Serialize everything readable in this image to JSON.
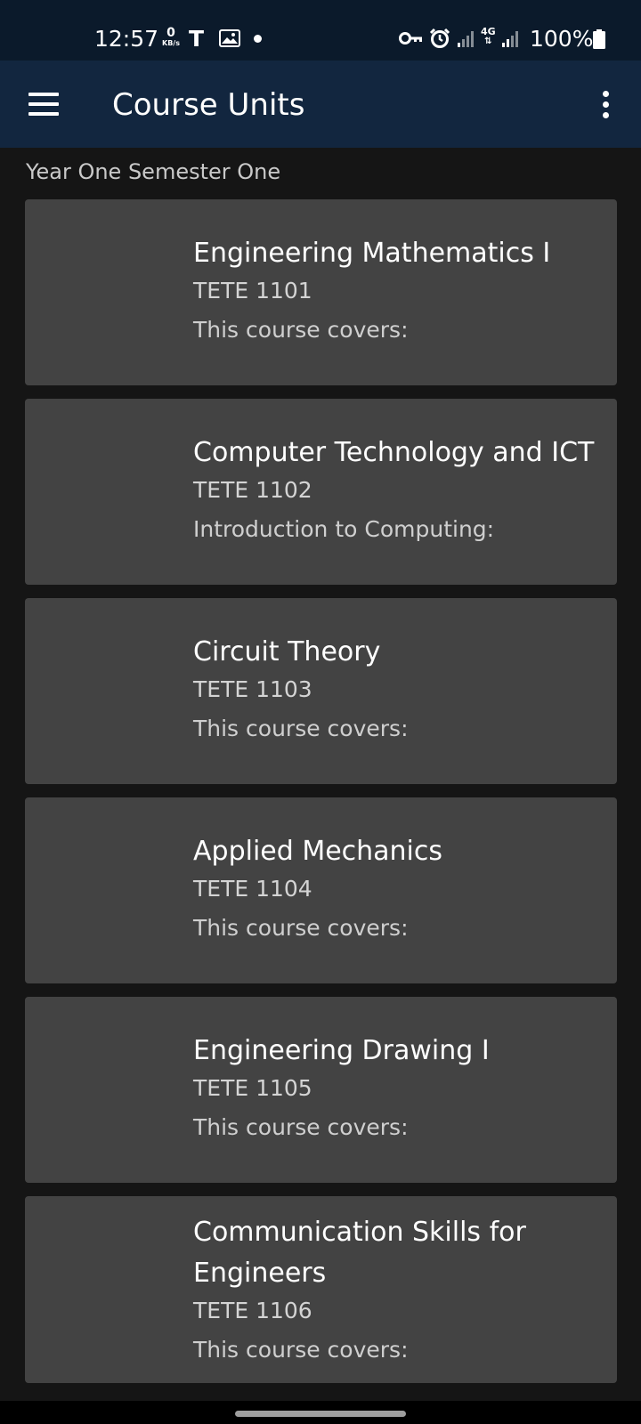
{
  "status_bar": {
    "time": "12:57",
    "data_rate_value": "0",
    "data_rate_unit": "KB/s",
    "t_icon_label": "T",
    "network_type": "4G",
    "battery_text": "100%",
    "icons": [
      "kbs-indicator",
      "t-notification-icon",
      "image-icon",
      "dot-icon",
      "vpn-key-icon",
      "alarm-icon",
      "signal-icon",
      "4g-icon",
      "signal-icon",
      "battery-icon"
    ]
  },
  "app_bar": {
    "title": "Course Units",
    "menu_icon": "hamburger-menu-icon",
    "overflow_icon": "more-vertical-icon"
  },
  "section": {
    "label": "Year One Semester One"
  },
  "courses": [
    {
      "title": "Engineering Mathematics I",
      "code": "TETE 1101",
      "description": "This course covers:"
    },
    {
      "title": "Computer Technology and ICT",
      "code": "TETE 1102",
      "description": "Introduction to Computing:"
    },
    {
      "title": "Circuit Theory",
      "code": "TETE 1103",
      "description": "This course covers:"
    },
    {
      "title": "Applied Mechanics",
      "code": "TETE 1104",
      "description": "This course covers:"
    },
    {
      "title": "Engineering Drawing I",
      "code": "TETE 1105",
      "description": "This course covers:"
    },
    {
      "title": "Communication Skills for Engineers",
      "code": "TETE 1106",
      "description": "This course covers:"
    }
  ],
  "colors": {
    "status_bar_bg": "#0b1a2b",
    "app_bar_bg": "#12263f",
    "background": "#151515",
    "card_bg": "#434343",
    "text_primary": "#ffffff",
    "text_secondary": "#d4d4d4"
  }
}
